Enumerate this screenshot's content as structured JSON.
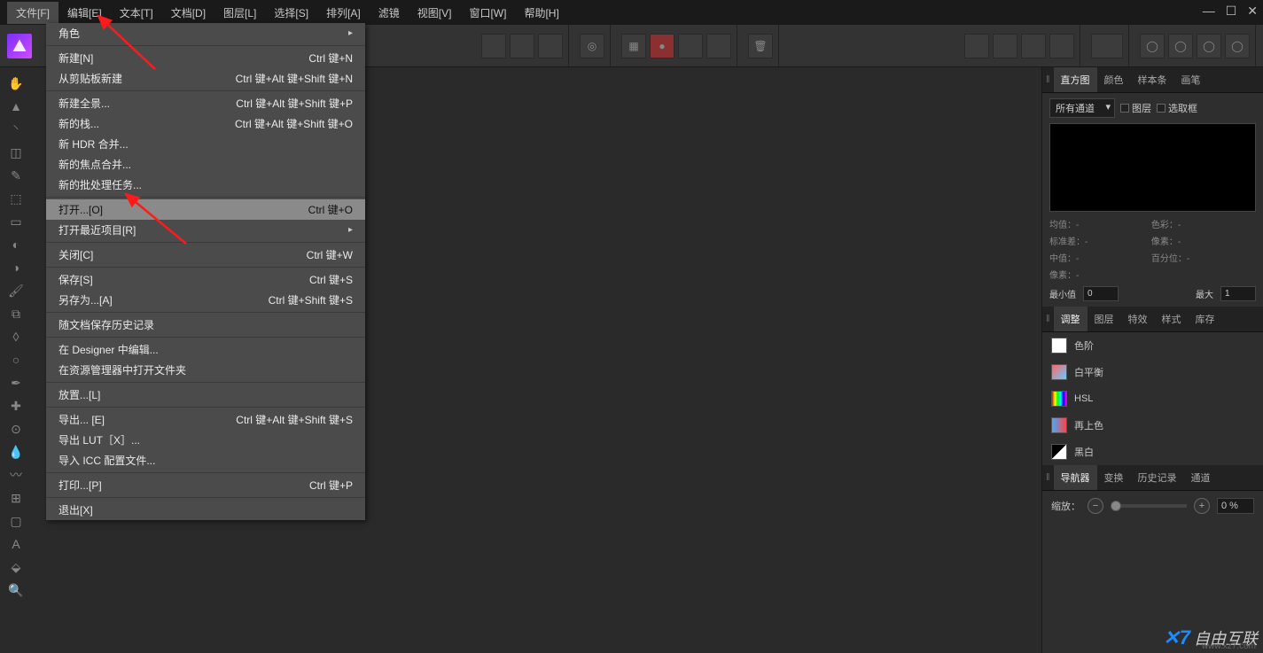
{
  "menubar": {
    "items": [
      {
        "label": "文件[F]",
        "active": true
      },
      {
        "label": "编辑[E]"
      },
      {
        "label": "文本[T]"
      },
      {
        "label": "文档[D]"
      },
      {
        "label": "图层[L]"
      },
      {
        "label": "选择[S]"
      },
      {
        "label": "排列[A]"
      },
      {
        "label": "滤镜"
      },
      {
        "label": "视图[V]"
      },
      {
        "label": "窗口[W]"
      },
      {
        "label": "帮助[H]"
      }
    ]
  },
  "file_menu": {
    "groups": [
      [
        {
          "label": "角色",
          "shortcut": "",
          "submenu": true
        }
      ],
      [
        {
          "label": "新建[N]",
          "shortcut": "Ctrl 键+N"
        },
        {
          "label": "从剪贴板新建",
          "shortcut": "Ctrl 键+Alt 键+Shift 键+N"
        }
      ],
      [
        {
          "label": "新建全景...",
          "shortcut": "Ctrl 键+Alt 键+Shift 键+P"
        },
        {
          "label": "新的栈...",
          "shortcut": "Ctrl 键+Alt 键+Shift 键+O"
        },
        {
          "label": "新 HDR 合并...",
          "shortcut": ""
        },
        {
          "label": "新的焦点合并...",
          "shortcut": ""
        },
        {
          "label": "新的批处理任务...",
          "shortcut": ""
        }
      ],
      [
        {
          "label": "打开...[O]",
          "shortcut": "Ctrl 键+O",
          "hover": true
        },
        {
          "label": "打开最近项目[R]",
          "shortcut": "",
          "submenu": true
        }
      ],
      [
        {
          "label": "关闭[C]",
          "shortcut": "Ctrl 键+W"
        }
      ],
      [
        {
          "label": "保存[S]",
          "shortcut": "Ctrl 键+S"
        },
        {
          "label": "另存为...[A]",
          "shortcut": "Ctrl 键+Shift 键+S"
        }
      ],
      [
        {
          "label": "随文档保存历史记录",
          "shortcut": ""
        }
      ],
      [
        {
          "label": "在 Designer 中编辑...",
          "shortcut": ""
        },
        {
          "label": "在资源管理器中打开文件夹",
          "shortcut": ""
        }
      ],
      [
        {
          "label": "放置...[L]",
          "shortcut": ""
        }
      ],
      [
        {
          "label": "导出... [E]",
          "shortcut": "Ctrl 键+Alt 键+Shift 键+S"
        },
        {
          "label": "导出 LUT［X］...",
          "shortcut": ""
        },
        {
          "label": "导入 ICC 配置文件...",
          "shortcut": ""
        }
      ],
      [
        {
          "label": "打印...[P]",
          "shortcut": "Ctrl 键+P"
        }
      ],
      [
        {
          "label": "退出[X]",
          "shortcut": ""
        }
      ]
    ]
  },
  "right": {
    "tabs1": [
      "直方图",
      "颜色",
      "样本条",
      "画笔"
    ],
    "channel_select": "所有通道",
    "cb_layer": "图层",
    "cb_selection": "选取框",
    "stats": {
      "mean_l": "均值：-",
      "color_l": "色彩：-",
      "stddev_l": "标准差：-",
      "pixels_l": "像素：-",
      "median_l": "中值：-",
      "percentile_l": "百分位：-",
      "count_l": "像素：-"
    },
    "min_label": "最小值",
    "min_value": "0",
    "max_label": "最大",
    "max_value": "1",
    "tabs2": [
      "调整",
      "图层",
      "特效",
      "样式",
      "库存"
    ],
    "adjustments": [
      {
        "name": "色阶",
        "ico": "◣",
        "class": "levels"
      },
      {
        "name": "白平衡",
        "ico": "◧",
        "class": "whitebalance"
      },
      {
        "name": "HSL",
        "ico": "▦",
        "class": "hsl"
      },
      {
        "name": "再上色",
        "ico": "▥",
        "class": "recolor"
      },
      {
        "name": "黑白",
        "ico": "◪",
        "class": "bw"
      }
    ],
    "tabs3": [
      "导航器",
      "变换",
      "历史记录",
      "通道"
    ],
    "zoom_label": "缩放：",
    "zoom_value": "0 %"
  },
  "watermark": {
    "cn": "自由互联",
    "url": "www.xz7.com"
  }
}
